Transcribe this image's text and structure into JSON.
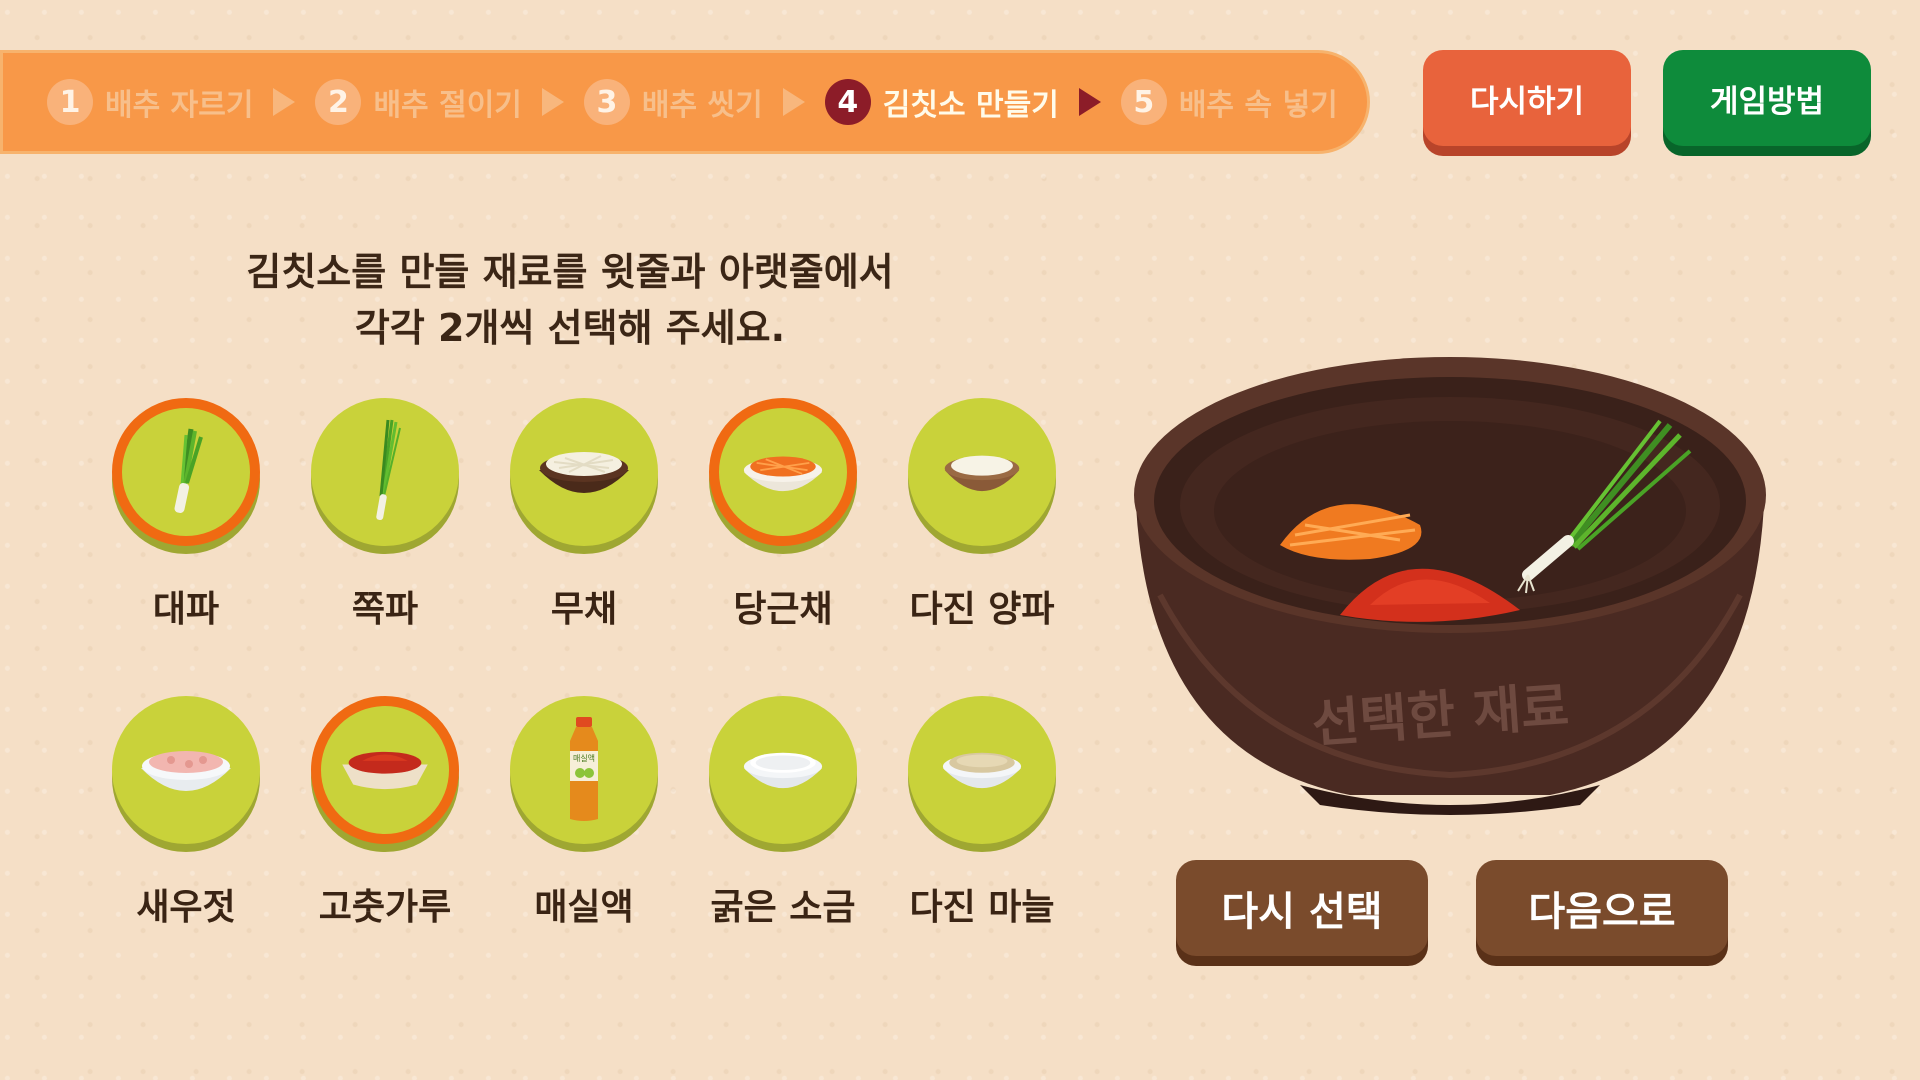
{
  "progress": {
    "steps": [
      {
        "num": "1",
        "label": "배추 자르기",
        "active": false
      },
      {
        "num": "2",
        "label": "배추 절이기",
        "active": false
      },
      {
        "num": "3",
        "label": "배추 씻기",
        "active": false
      },
      {
        "num": "4",
        "label": "김칫소 만들기",
        "active": true
      },
      {
        "num": "5",
        "label": "배추 속 넣기",
        "active": false
      }
    ]
  },
  "buttons": {
    "retry": "다시하기",
    "howto": "게임방법",
    "reselect": "다시 선택",
    "next": "다음으로"
  },
  "instruction": {
    "line1": "김칫소를 만들 재료를 윗줄과 아랫줄에서",
    "line2": "각각 2개씩 선택해 주세요."
  },
  "ingredients": {
    "top": [
      {
        "label": "대파",
        "icon": "green-onion-icon",
        "selected": true
      },
      {
        "label": "쪽파",
        "icon": "chive-icon",
        "selected": false
      },
      {
        "label": "무채",
        "icon": "radish-strips-icon",
        "selected": false
      },
      {
        "label": "당근채",
        "icon": "carrot-strips-icon",
        "selected": true
      },
      {
        "label": "다진 양파",
        "icon": "minced-onion-icon",
        "selected": false
      }
    ],
    "bottom": [
      {
        "label": "새우젓",
        "icon": "salted-shrimp-icon",
        "selected": false
      },
      {
        "label": "고춧가루",
        "icon": "red-pepper-powder-icon",
        "selected": true
      },
      {
        "label": "매실액",
        "icon": "plum-extract-bottle-icon",
        "selected": false,
        "bottle_text": "매실액"
      },
      {
        "label": "굵은 소금",
        "icon": "coarse-salt-icon",
        "selected": false
      },
      {
        "label": "다진 마늘",
        "icon": "minced-garlic-icon",
        "selected": false
      }
    ]
  },
  "bowl": {
    "label": "선택한 재료",
    "contents": [
      "carrot-strips",
      "red-pepper-powder",
      "green-onion"
    ]
  },
  "colors": {
    "progress_bg": "#f89848",
    "active_step": "#8c1c28",
    "retry": "#e8633c",
    "howto": "#0e8b3b",
    "disc": "#c9d23a",
    "selected_ring": "#f06a12",
    "brown_button": "#7a4b2c"
  }
}
